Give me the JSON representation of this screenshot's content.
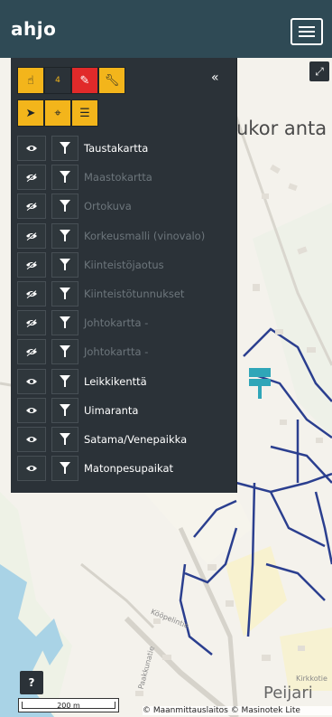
{
  "app": {
    "logo": "ahjo"
  },
  "header": {
    "menu_icon": "hamburger-icon"
  },
  "map": {
    "title_text": "ukor anta",
    "place_text": "Peijari",
    "street_1": "Kööpelintie",
    "street_2": "Paakkunatie",
    "street_3": "Kirkkotie",
    "attribution": "© Maanmittauslaitos © Masinotek Lite",
    "scale_label": "200 m",
    "help_label": "?",
    "expand_icon": "expand-icon"
  },
  "toolbar": {
    "row1": [
      {
        "icon": "pointer-hand-icon",
        "label": ""
      },
      {
        "icon": "badge-count",
        "label": "4"
      },
      {
        "icon": "pencil-icon",
        "label": ""
      },
      {
        "icon": "wrench-icon",
        "label": ""
      }
    ],
    "row2": [
      {
        "icon": "navigate-arrow-icon"
      },
      {
        "icon": "crosshair-icon"
      },
      {
        "icon": "layers-list-icon"
      }
    ],
    "collapse_label": "«"
  },
  "layers": [
    {
      "name": "Taustakartta",
      "visible": true
    },
    {
      "name": "Maastokartta",
      "visible": false
    },
    {
      "name": "Ortokuva",
      "visible": false
    },
    {
      "name": "Korkeusmalli (vinovalo)",
      "visible": false
    },
    {
      "name": "Kiinteistöjaotus",
      "visible": false
    },
    {
      "name": "Kiinteistötunnukset",
      "visible": false
    },
    {
      "name": "Johtokartta -",
      "visible": false
    },
    {
      "name": "Johtokartta -",
      "visible": false
    },
    {
      "name": "Leikkikenttä",
      "visible": true
    },
    {
      "name": "Uimaranta",
      "visible": true
    },
    {
      "name": "Satama/Venepaikka",
      "visible": true
    },
    {
      "name": "Matonpesupaikat",
      "visible": true
    }
  ],
  "colors": {
    "header": "#2f4a55",
    "panel": "#2b3238",
    "accent_yellow": "#f3b51b",
    "accent_red": "#e12a2a",
    "road_blue": "#2b3f8f",
    "water": "#a9d3e6"
  }
}
